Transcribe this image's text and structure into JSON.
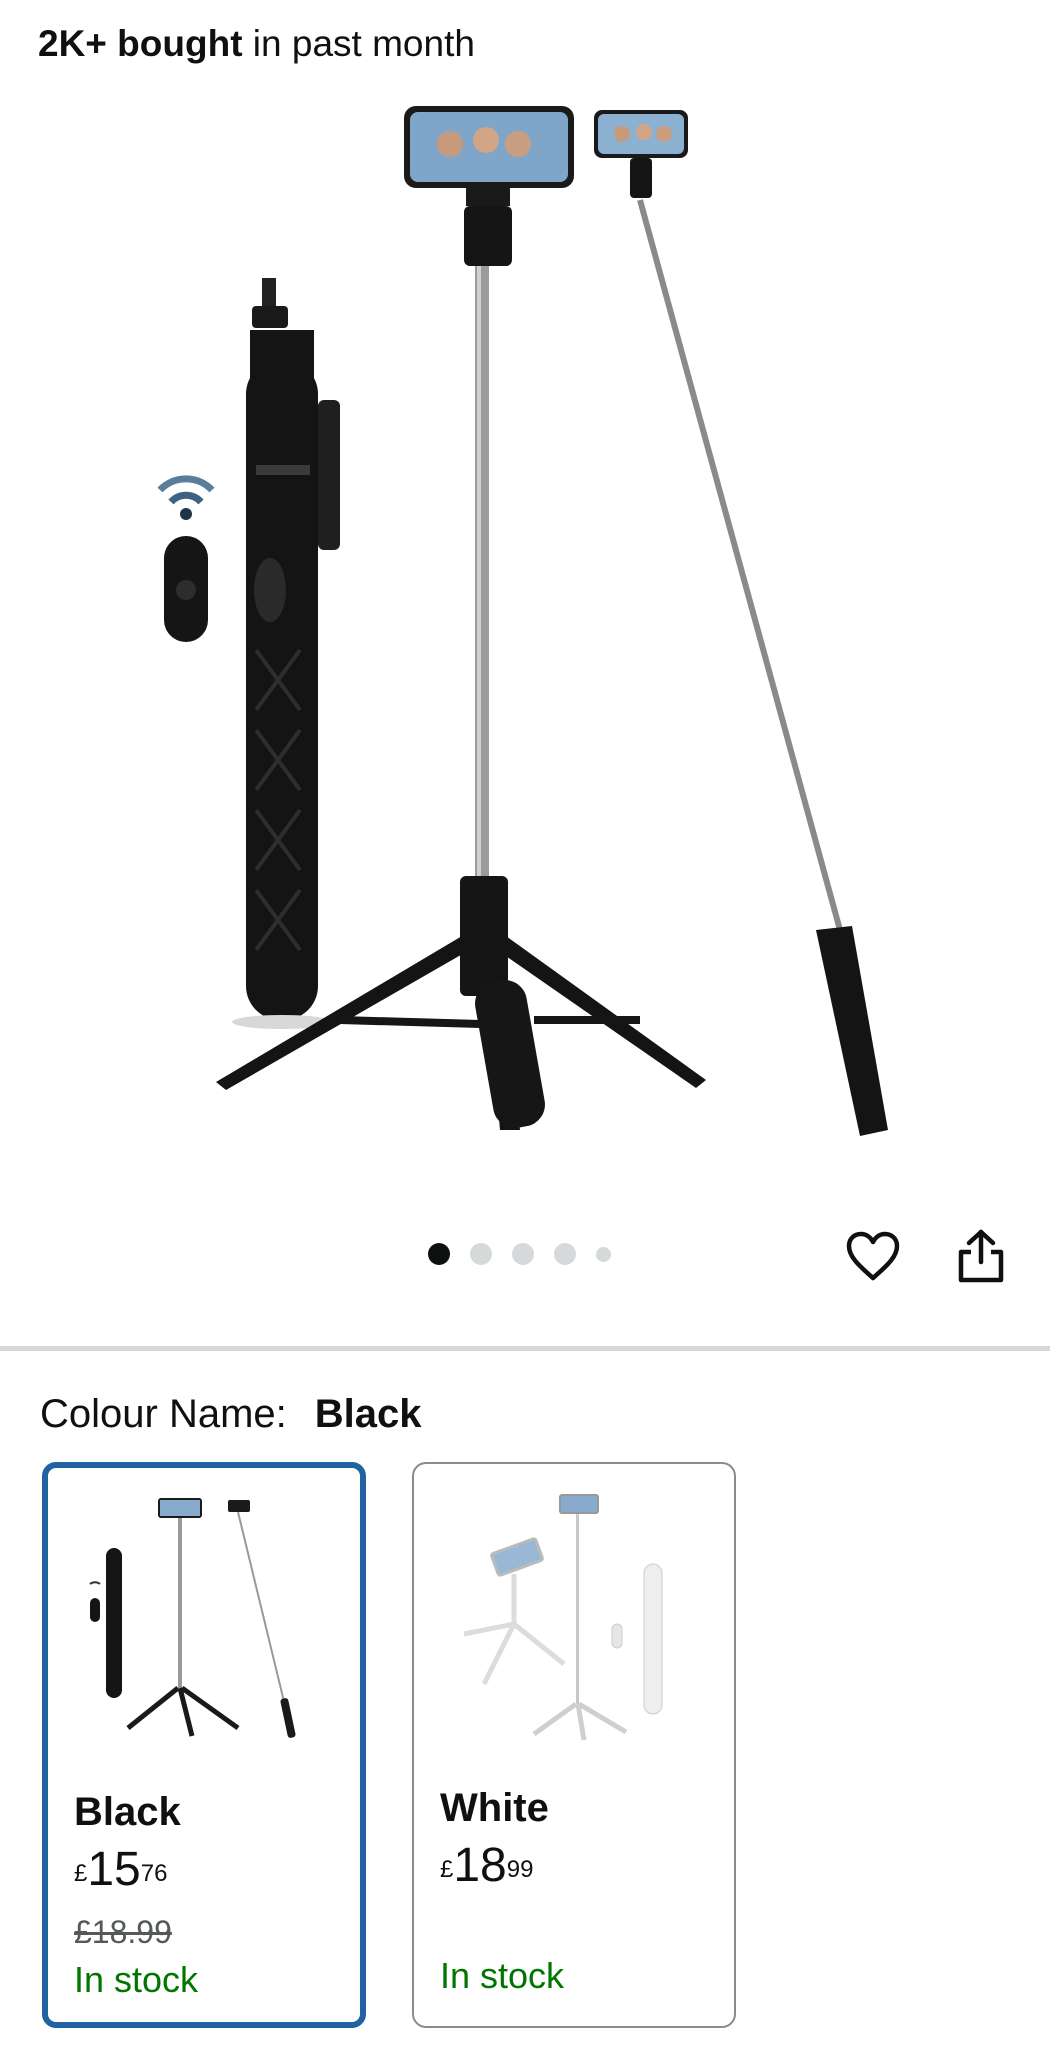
{
  "header": {
    "bought_bold": "2K+ bought",
    "bought_rest": " in past month"
  },
  "gallery": {
    "image_count": 5,
    "active_index": 0,
    "product_color": "#111111",
    "wishlist_icon": "heart-outline-icon",
    "share_icon": "share-icon"
  },
  "variation": {
    "label": "Colour Name:",
    "selected": "Black",
    "options": [
      {
        "name": "Black",
        "currency": "£",
        "price_whole": "15",
        "price_fraction": "76",
        "was_price": "£18.99",
        "stock": "In stock",
        "selected": true,
        "border_color": "#2162a1"
      },
      {
        "name": "White",
        "currency": "£",
        "price_whole": "18",
        "price_fraction": "99",
        "stock": "In stock",
        "selected": false,
        "border_color": "#888c8c"
      }
    ]
  },
  "colors": {
    "stock_green": "#007600",
    "selected_blue": "#2162a1",
    "divider": "#d5d9d9"
  }
}
